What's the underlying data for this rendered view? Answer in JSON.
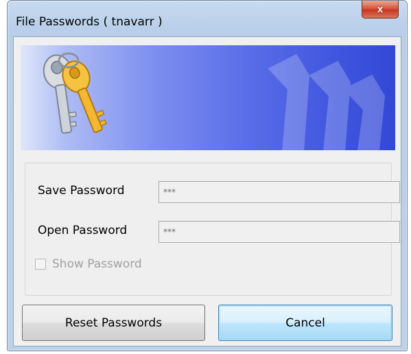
{
  "window": {
    "title": "File Passwords ( tnavarr )",
    "close_label": "x"
  },
  "form": {
    "save_password_label": "Save Password",
    "save_password_value": "***",
    "open_password_label": "Open Password",
    "open_password_value": "***",
    "show_password_label": "Show Password",
    "show_password_checked": false
  },
  "buttons": {
    "reset_label": "Reset Passwords",
    "cancel_label": "Cancel"
  },
  "colors": {
    "banner_light": "#dfe6fb",
    "banner_dark": "#3348d6",
    "close_red": "#c8381f",
    "default_button_border": "#3c7fb1"
  },
  "icons": {
    "banner_icon": "keys-icon",
    "watermark_icon": "keys-watermark-icon",
    "close_icon": "close-icon"
  }
}
